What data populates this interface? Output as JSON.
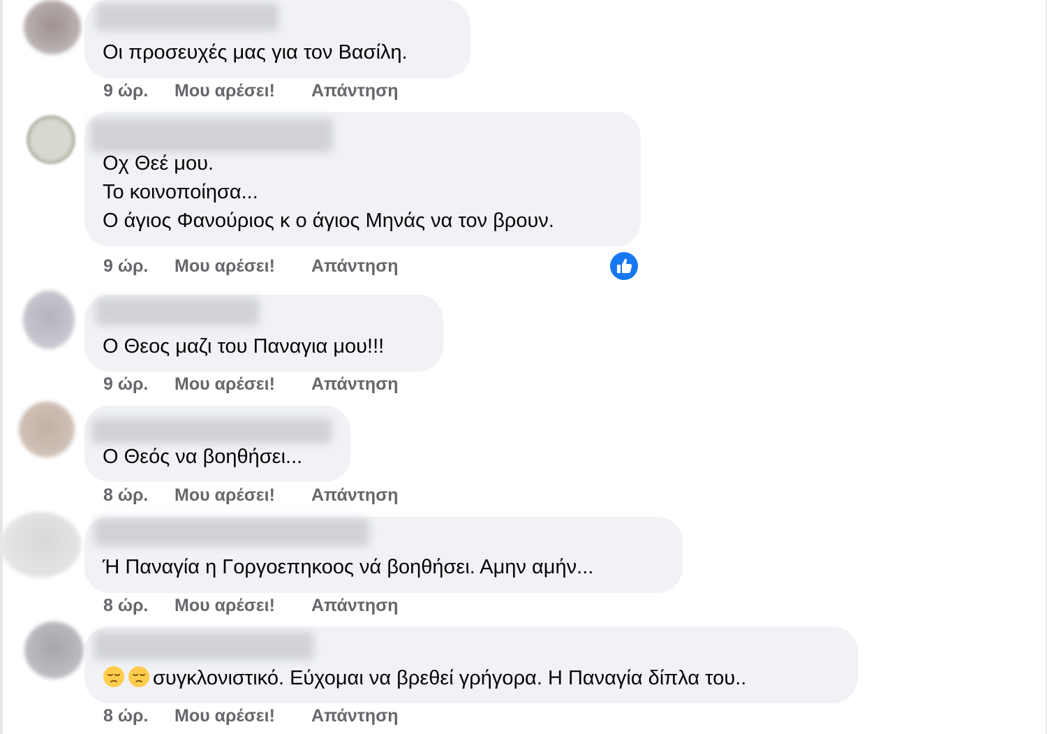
{
  "actions": {
    "like_label": "Μου αρέσει!",
    "reply_label": "Απάντηση"
  },
  "comments": [
    {
      "lines": [
        "Οι προσευχές μας για τον Βασίλη."
      ],
      "time": "9 ώρ."
    },
    {
      "lines": [
        "Οχ Θεέ μου.",
        "Το κοινοποίησα...",
        "Ο άγιος Φανούριος κ ο άγιος Μηνάς να τον βρουν."
      ],
      "time": "9 ώρ.",
      "reaction": "like-reaction-icon"
    },
    {
      "lines": [
        "Ο Θεος μαζι του Παναγια μου!!!"
      ],
      "time": "9 ώρ."
    },
    {
      "lines": [
        "Ο Θεός να βοηθήσει..."
      ],
      "time": "8 ώρ."
    },
    {
      "lines": [
        "Ή Παναγία η Γοργοεπηκοος νά βοηθήσει. Αμην αμήν..."
      ],
      "time": "8 ώρ."
    },
    {
      "lines": [
        "συγκλονιστικό. Εύχομαι να βρεθεί γρήγορα. Η Παναγία δίπλα του.."
      ],
      "emoji_prefix": [
        "pensive-face-icon",
        "pensive-face-icon"
      ],
      "time": "8 ώρ."
    }
  ],
  "colors": {
    "bubble": "#f0f2f5",
    "meta_text": "#65676b",
    "like_blue": "#1877f2"
  }
}
